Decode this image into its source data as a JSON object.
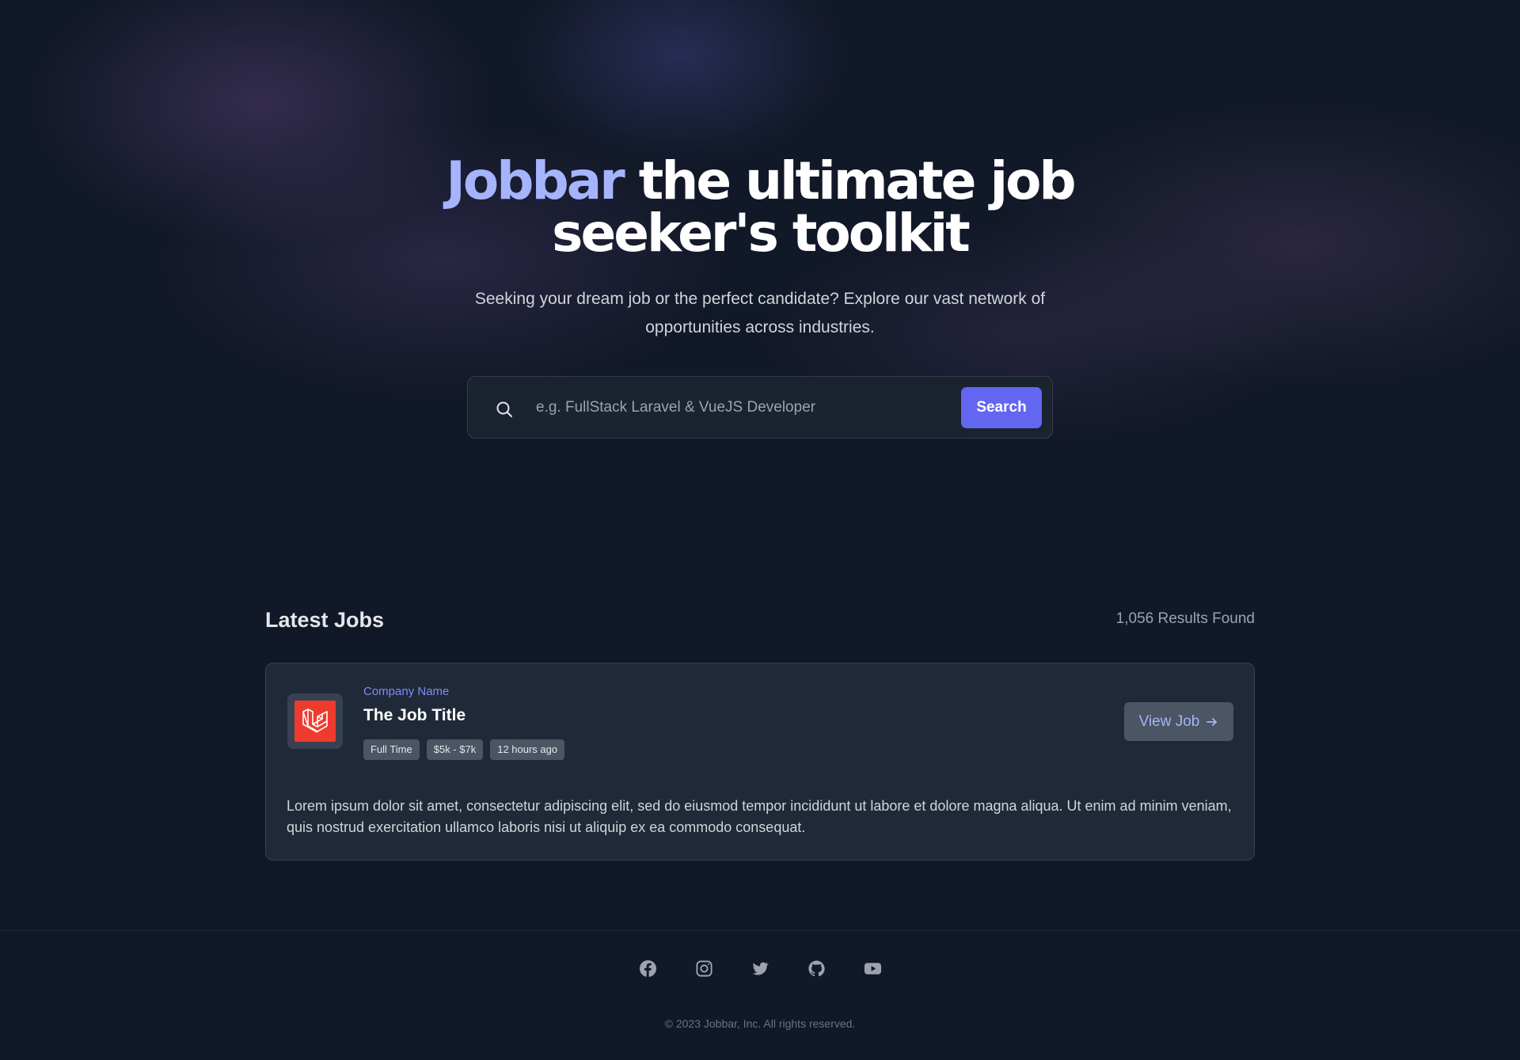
{
  "hero": {
    "brand": "Jobbar",
    "headline_line1": " the ultimate job",
    "headline_line2": "seeker's toolkit",
    "subtitle": "Seeking your dream job or the perfect candidate? Explore our vast network of opportunities across industries."
  },
  "search": {
    "placeholder": "e.g. FullStack Laravel & VueJS Developer",
    "value": "",
    "button_label": "Search",
    "icon": "search-icon"
  },
  "jobs_section": {
    "title": "Latest Jobs",
    "results": "1,056 Results Found"
  },
  "job": {
    "company": "Company Name",
    "title": "The Job Title",
    "logo_icon": "laravel-logo-icon",
    "tags": [
      "Full Time",
      "$5k - $7k",
      "12 hours ago"
    ],
    "view_button": "View Job",
    "description": "Lorem ipsum dolor sit amet, consectetur adipiscing elit, sed do eiusmod tempor incididunt ut labore et dolore magna aliqua. Ut enim ad minim veniam, quis nostrud exercitation ullamco laboris nisi ut aliquip ex ea commodo consequat."
  },
  "footer": {
    "socials": [
      "facebook-icon",
      "instagram-icon",
      "twitter-icon",
      "github-icon",
      "youtube-icon"
    ],
    "copyright": "© 2023 Jobbar, Inc. All rights reserved."
  },
  "colors": {
    "background": "#111827",
    "accent": "#6366f1",
    "brand_text": "#a5b4fc",
    "card": "#1f2937",
    "laravel_red": "#ef3b2d"
  }
}
